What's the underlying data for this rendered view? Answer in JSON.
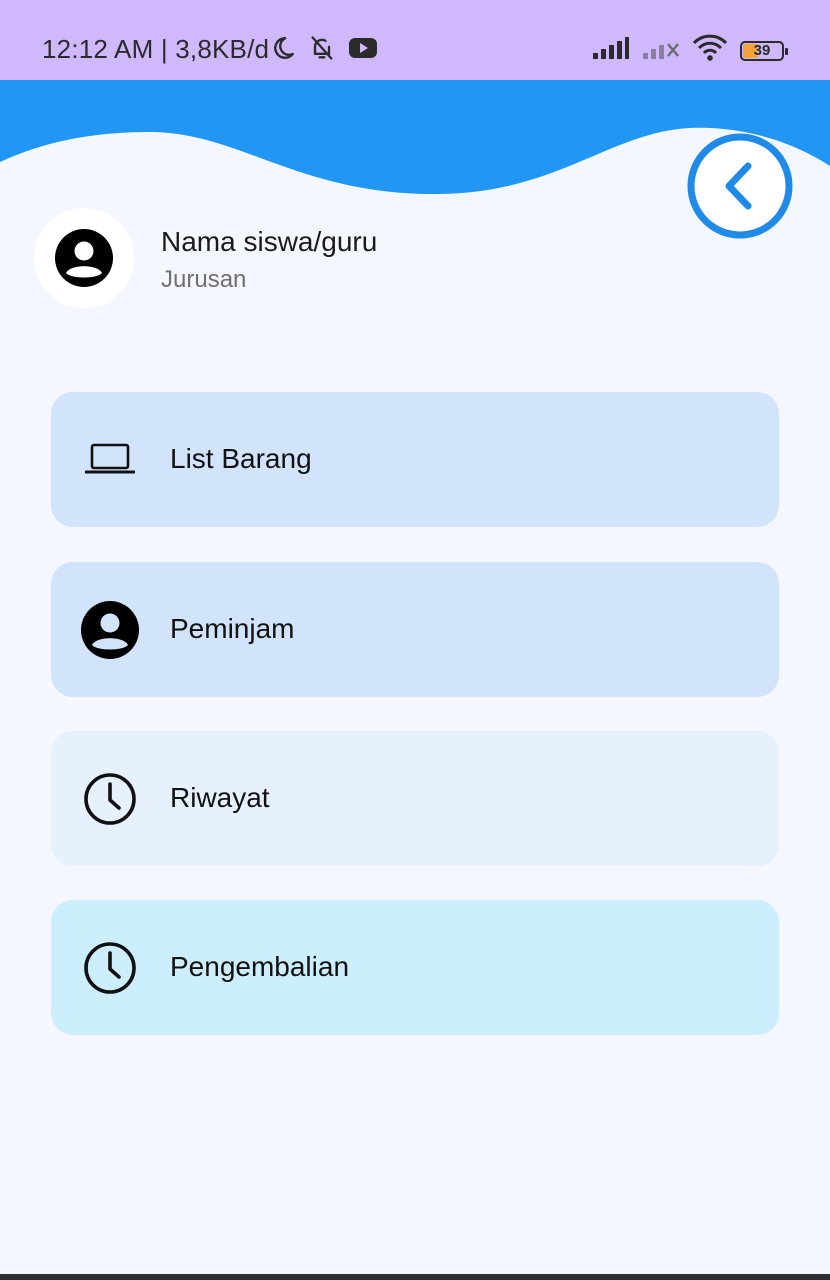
{
  "status_bar": {
    "time_text": "12:12 AM | 3,8KB/d",
    "battery_level": "39",
    "icons": [
      "moon-icon",
      "bell-off-icon",
      "youtube-icon",
      "signal-icon",
      "signal-no-sim-icon",
      "wifi-icon",
      "battery-icon"
    ]
  },
  "header": {
    "accent_color": "#2196f3",
    "back_icon": "chevron-left-icon"
  },
  "profile": {
    "name": "Nama siswa/guru",
    "subtitle": "Jurusan",
    "avatar_icon": "account-circle-icon"
  },
  "menu": {
    "items": [
      {
        "label": "List Barang",
        "icon": "laptop-icon",
        "bg": "#d2e3fc"
      },
      {
        "label": "Peminjam",
        "icon": "account-circle-icon",
        "bg": "#d2e3fc"
      },
      {
        "label": "Riwayat",
        "icon": "clock-icon",
        "bg": "#e7f0fd"
      },
      {
        "label": "Pengembalian",
        "icon": "clock-icon",
        "bg": "#cdeffd"
      }
    ]
  }
}
